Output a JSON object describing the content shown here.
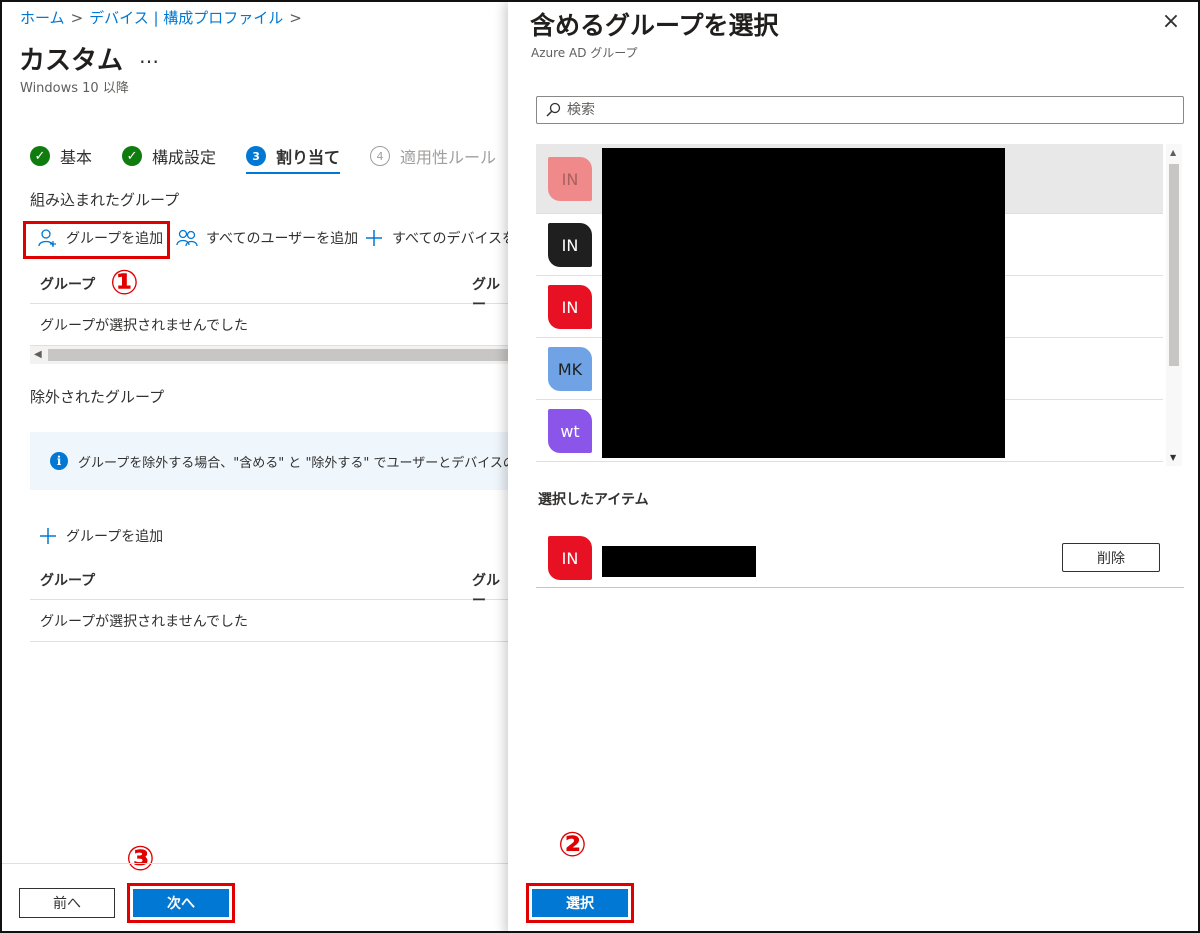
{
  "breadcrumb": {
    "items": [
      "ホーム",
      "デバイス | 構成プロファイル"
    ],
    "separator": ">"
  },
  "page": {
    "title": "カスタム",
    "more": "…",
    "subtitle": "Windows 10 以降"
  },
  "steps": [
    {
      "label": "基本",
      "state": "done",
      "marker": "✓"
    },
    {
      "label": "構成設定",
      "state": "done",
      "marker": "✓"
    },
    {
      "label": "割り当て",
      "state": "current",
      "marker": "3"
    },
    {
      "label": "適用性ルール",
      "state": "disabled",
      "marker": "4"
    }
  ],
  "included": {
    "label": "組み込まれたグループ",
    "add_group": "グループを追加",
    "add_all_users": "すべてのユーザーを追加",
    "add_all_devices": "すべてのデバイスを追",
    "columns": [
      "グループ",
      "グルー"
    ],
    "empty": "グループが選択されませんでした"
  },
  "excluded": {
    "label": "除外されたグループ",
    "info": "グループを除外する場合、\"含める\" と \"除外する\" でユーザーとデバイスのグルー",
    "add_group": "グループを追加",
    "columns": [
      "グループ",
      "グルー"
    ],
    "empty": "グループが選択されませんでした"
  },
  "annotations": {
    "one": "①",
    "two": "②",
    "three": "③"
  },
  "footer": {
    "prev": "前へ",
    "next": "次へ"
  },
  "panel": {
    "title": "含めるグループを選択",
    "subtitle": "Azure AD グループ",
    "close": "×",
    "search_placeholder": "検索",
    "groups": [
      {
        "initials": "IN",
        "color": "#f08a8a",
        "text_color": "#a86060"
      },
      {
        "initials": "IN",
        "color": "#1f1f1f",
        "text_color": "#ffffff"
      },
      {
        "initials": "IN",
        "color": "#e81123",
        "text_color": "#ffffff"
      },
      {
        "initials": "MK",
        "color": "#6fa3e6",
        "text_color": "#1f1f1f"
      },
      {
        "initials": "wt",
        "color": "#8a55e8",
        "text_color": "#ffffff"
      }
    ],
    "selected_label": "選択したアイテム",
    "selected_items": [
      {
        "initials": "IN",
        "color": "#e81123",
        "text_color": "#ffffff"
      }
    ],
    "remove": "削除",
    "select": "選択"
  },
  "colors": {
    "accent": "#0078d4",
    "success": "#107c10",
    "annotation_red": "#e00000"
  }
}
